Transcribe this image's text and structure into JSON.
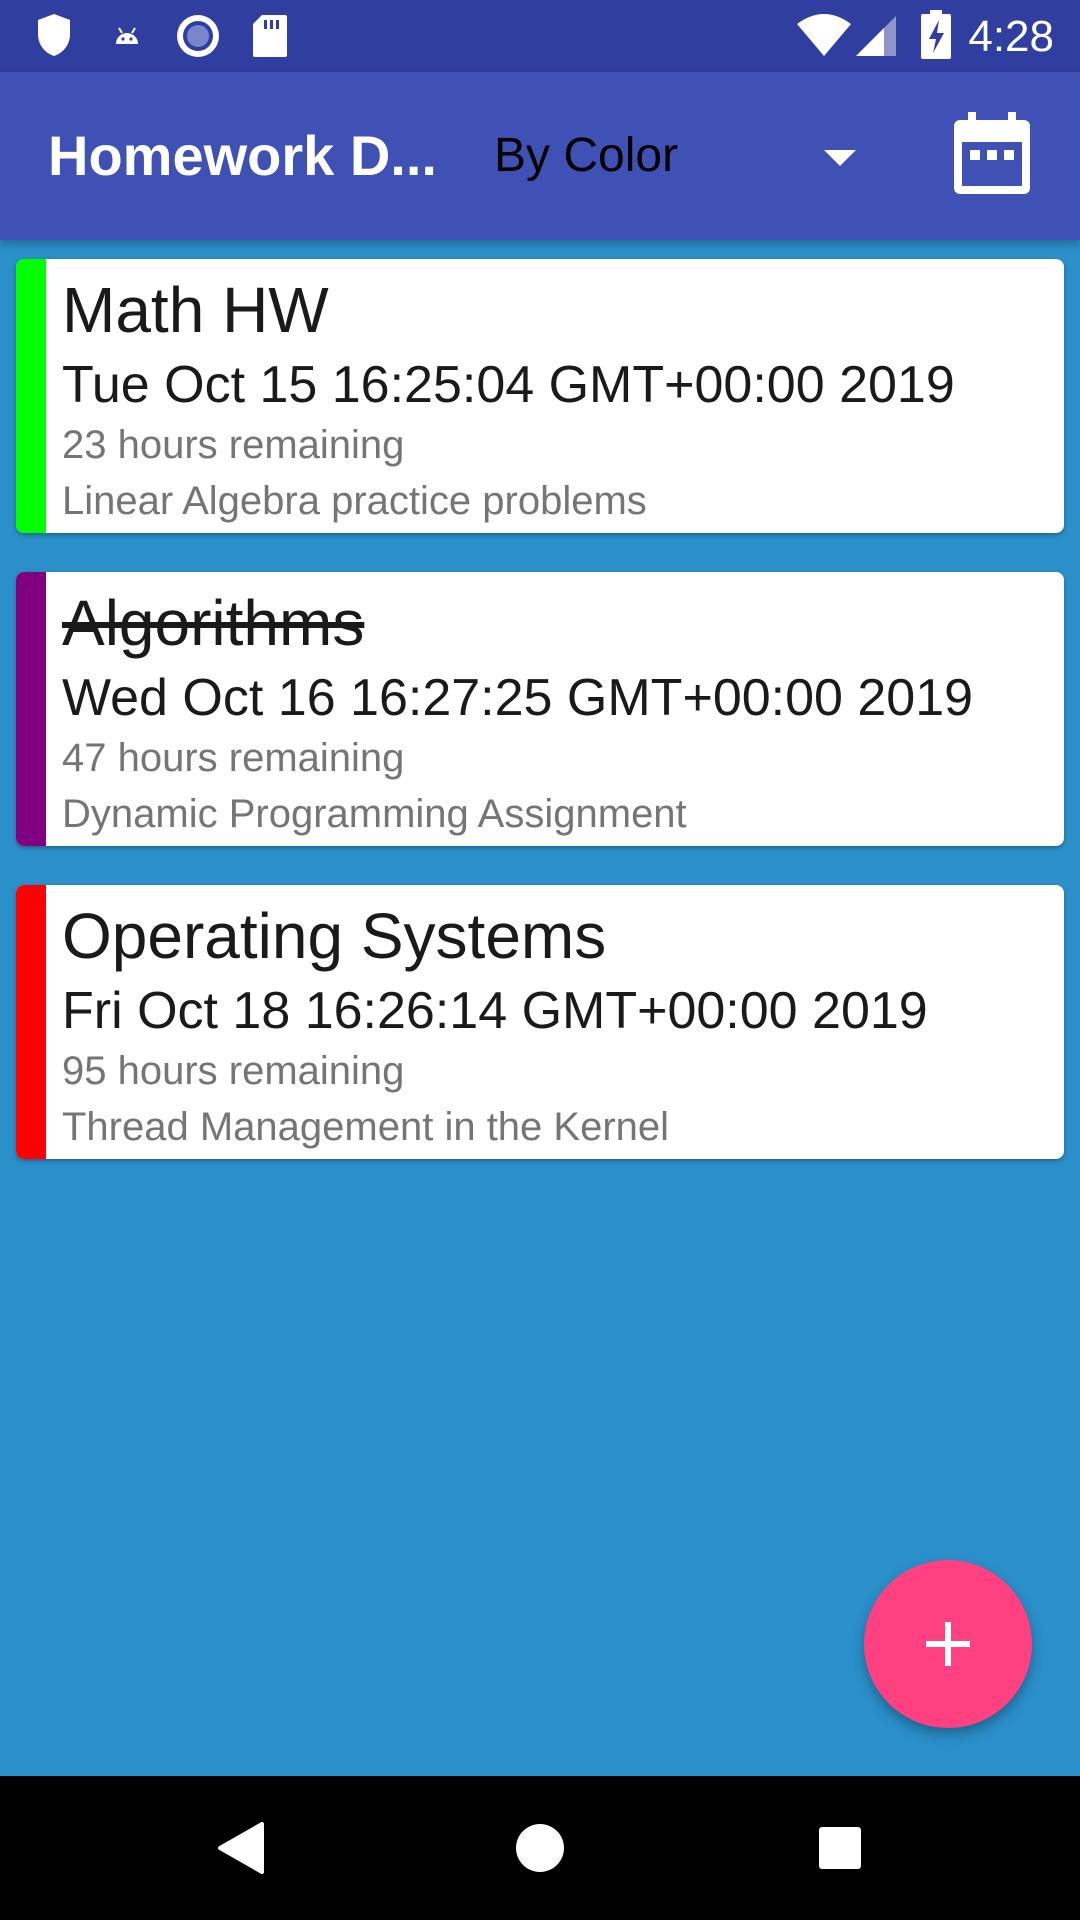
{
  "status_bar": {
    "time": "4:28",
    "icons": [
      "shield-icon",
      "android-icon",
      "record-icon",
      "sd-card-icon",
      "wifi-icon",
      "signal-icon",
      "battery-charging-icon"
    ]
  },
  "app_bar": {
    "title": "Homework D...",
    "sort_selected": "By Color",
    "calendar_icon": "calendar-icon"
  },
  "colors": {
    "status_bar": "#303f9f",
    "app_bar": "#3f51b5",
    "background": "#2b8fca",
    "fab": "#ff4081"
  },
  "assignments": [
    {
      "title": "Math HW",
      "due": "Tue Oct 15 16:25:04 GMT+00:00 2019",
      "remaining": "23 hours remaining",
      "description": "Linear Algebra practice problems",
      "color": "#00ff00",
      "completed": false
    },
    {
      "title": "Algorithms",
      "due": "Wed Oct 16 16:27:25 GMT+00:00 2019",
      "remaining": "47 hours remaining",
      "description": "Dynamic Programming Assignment",
      "color": "#800080",
      "completed": true
    },
    {
      "title": "Operating Systems",
      "due": "Fri Oct 18 16:26:14 GMT+00:00 2019",
      "remaining": "95 hours remaining",
      "description": "Thread Management in the Kernel",
      "color": "#ff0000",
      "completed": false
    }
  ],
  "fab": {
    "icon": "plus-icon"
  },
  "nav_bar": {
    "icons": [
      "back-icon",
      "home-icon",
      "recents-icon"
    ]
  }
}
